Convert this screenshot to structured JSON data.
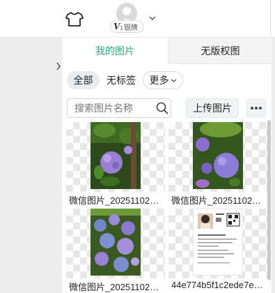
{
  "header": {
    "rank_prefix": "V",
    "rank_level": "1",
    "rank_label": "银牌"
  },
  "tabs": [
    {
      "label": "我的图片",
      "active": true
    },
    {
      "label": "无版权图",
      "active": false
    }
  ],
  "filters": {
    "all": "全部",
    "untagged": "无标签",
    "more": "更多"
  },
  "search": {
    "placeholder": "搜索图片名称"
  },
  "toolbar": {
    "upload_label": "上传图片"
  },
  "images": [
    {
      "name": "微信图片_20251102…"
    },
    {
      "name": "微信图片_20251102…"
    },
    {
      "name": "微信图片_20251102…"
    },
    {
      "name": "44e774b5f1c2ede7e…"
    }
  ],
  "colors": {
    "accent": "#2aa876"
  }
}
